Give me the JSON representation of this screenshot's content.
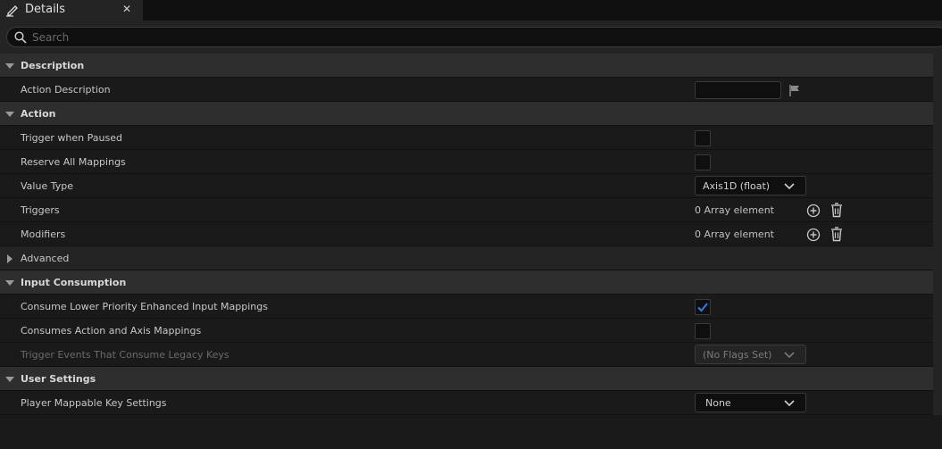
{
  "tab": {
    "title": "Details",
    "close_glyph": "✕"
  },
  "search": {
    "placeholder": "Search"
  },
  "description": {
    "header": "Description",
    "action_description_label": "Action Description"
  },
  "action": {
    "header": "Action",
    "trigger_when_paused_label": "Trigger when Paused",
    "reserve_all_mappings_label": "Reserve All Mappings",
    "value_type_label": "Value Type",
    "value_type_value": "Axis1D (float)",
    "triggers_label": "Triggers",
    "triggers_value": "0 Array element",
    "modifiers_label": "Modifiers",
    "modifiers_value": "0 Array element",
    "advanced_label": "Advanced"
  },
  "input_consumption": {
    "header": "Input Consumption",
    "consume_lower_label": "Consume Lower Priority Enhanced Input Mappings",
    "consume_lower_checked": true,
    "consumes_action_axis_label": "Consumes Action and Axis Mappings",
    "trigger_events_label": "Trigger Events That Consume Legacy Keys",
    "trigger_events_value": "(No Flags Set)"
  },
  "user_settings": {
    "header": "User Settings",
    "player_mappable_label": "Player Mappable Key Settings",
    "player_mappable_value": "None"
  },
  "colors": {
    "accent_check": "#2a7ff0"
  }
}
